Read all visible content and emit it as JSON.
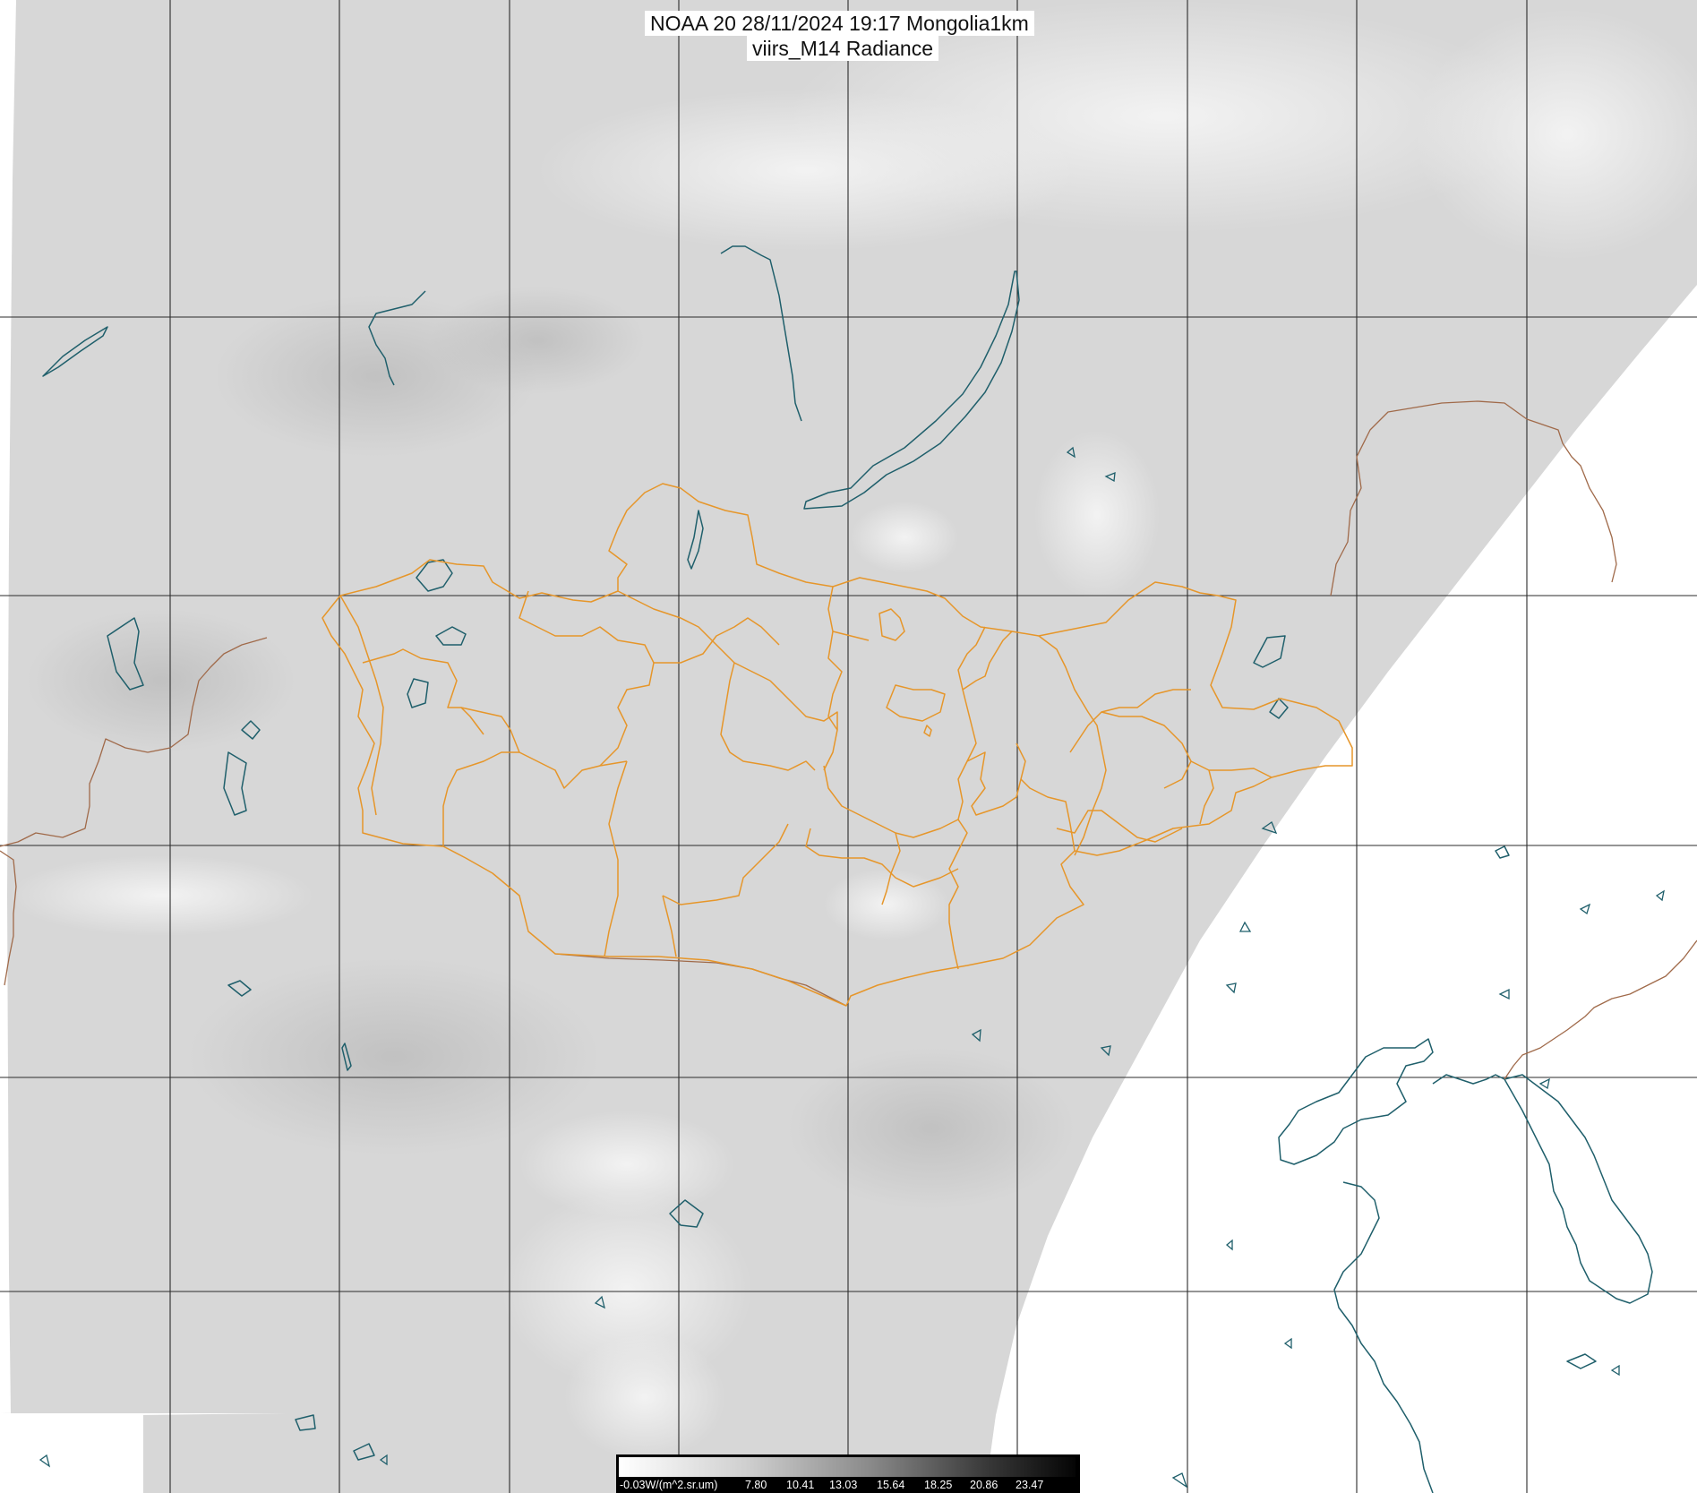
{
  "title": {
    "line1": "NOAA 20 28/11/2024 19:17 Mongolia1km",
    "line2": "viirs_M14 Radiance"
  },
  "legend": {
    "unit_label": "-0.03W/(m^2.sr.um)",
    "ticks": [
      "7.80",
      "10.41",
      "13.03",
      "15.64",
      "18.25",
      "20.86",
      "23.47"
    ],
    "ramp_colors": [
      "#ffffff",
      "#000000"
    ]
  },
  "colors": {
    "coastline": "#1f5f6b",
    "admin_boundary": "#e6962a",
    "country_border": "#a06a4a",
    "grid": "#2b2b2b",
    "swath_fill": "#d6d6d6",
    "no_data": "#ffffff"
  }
}
